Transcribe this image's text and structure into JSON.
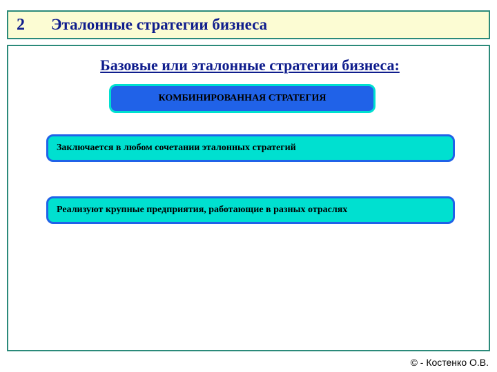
{
  "header": {
    "number": "2",
    "title": "Эталонные стратегии бизнеса"
  },
  "subheading": "Базовые или эталонные стратегии бизнеса:",
  "strategy_box": "КОМБИНИРОВАННАЯ СТРАТЕГИЯ",
  "detail_boxes": [
    "Заключается в любом сочетании эталонных стратегий",
    "Реализуют крупные предприятия, работающие в разных отраслях"
  ],
  "copyright": "© - Костенко О.В."
}
